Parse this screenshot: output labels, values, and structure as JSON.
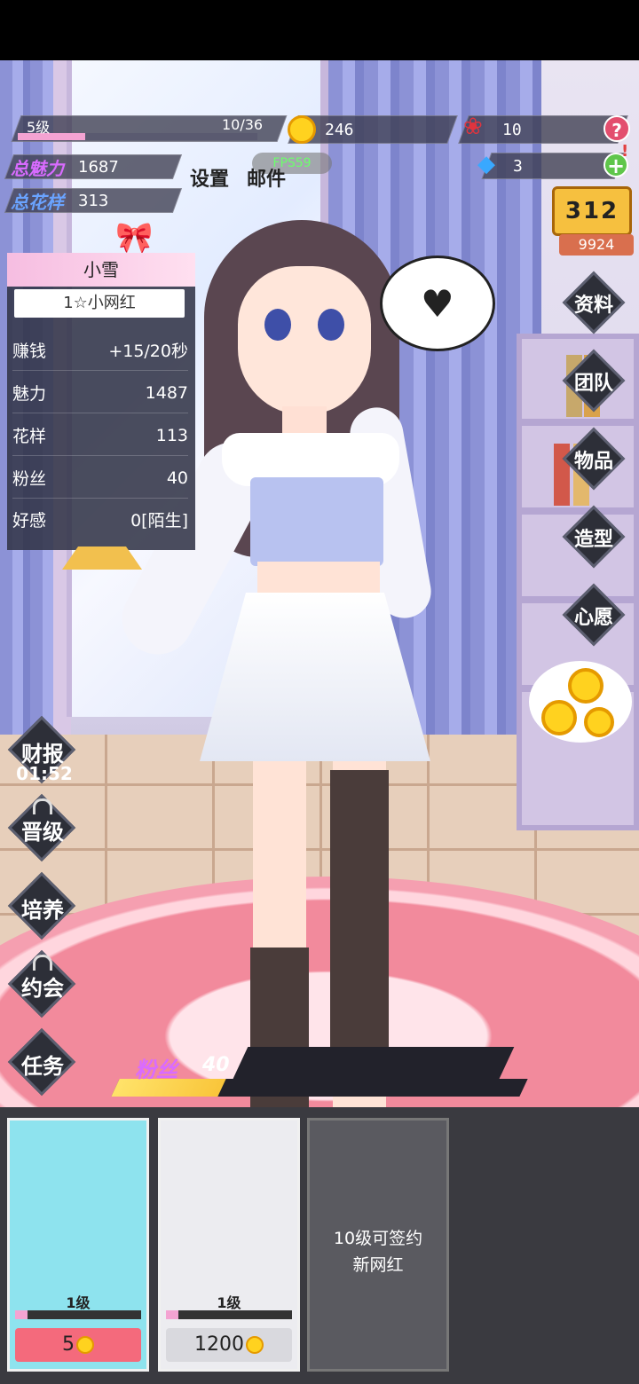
{
  "hud": {
    "level": "5级",
    "level_progress_text": "10/36",
    "level_progress": 0.28,
    "coins": "246",
    "roses": "10",
    "gems": "3",
    "help_label": "?",
    "add_label": "+",
    "alert_label": "!",
    "total_charm_label": "总魅力",
    "total_charm_value": "1687",
    "total_style_label": "总花样",
    "total_style_value": "313",
    "fps": "FPS59",
    "settings_label": "设置",
    "mail_label": "邮件",
    "rank_digits": "312",
    "rank_score": "9924"
  },
  "card": {
    "name": "小雪",
    "title": "1☆小网红",
    "rows": [
      {
        "label": "赚钱",
        "value": "+15/20秒"
      },
      {
        "label": "魅力",
        "value": "1487"
      },
      {
        "label": "花样",
        "value": "113"
      },
      {
        "label": "粉丝",
        "value": "40"
      },
      {
        "label": "好感",
        "value": "0[陌生]"
      }
    ]
  },
  "right_menu": [
    "资料",
    "团队",
    "物品",
    "造型",
    "心愿"
  ],
  "left_menu": {
    "report_label": "财报",
    "report_timer": "01:52",
    "items": [
      "晋级",
      "培养",
      "约会",
      "任务"
    ]
  },
  "fans": {
    "label": "粉丝",
    "value": "40",
    "progress": 0.26
  },
  "slots": [
    {
      "level": "1级",
      "price": "5",
      "progress": 0.1,
      "bg": "#8ee3ee",
      "price_bg": "#f46a7c"
    },
    {
      "level": "1级",
      "price": "1200",
      "progress": 0.1,
      "bg": "#ececf0",
      "price_bg": "#d9d9de"
    },
    {
      "lock_line1": "10级可签约",
      "lock_line2": "新网红"
    }
  ],
  "colors": {
    "accent_pink": "#f4a3d2",
    "accent_purple": "#d96bff",
    "gold": "#ffd21f"
  }
}
